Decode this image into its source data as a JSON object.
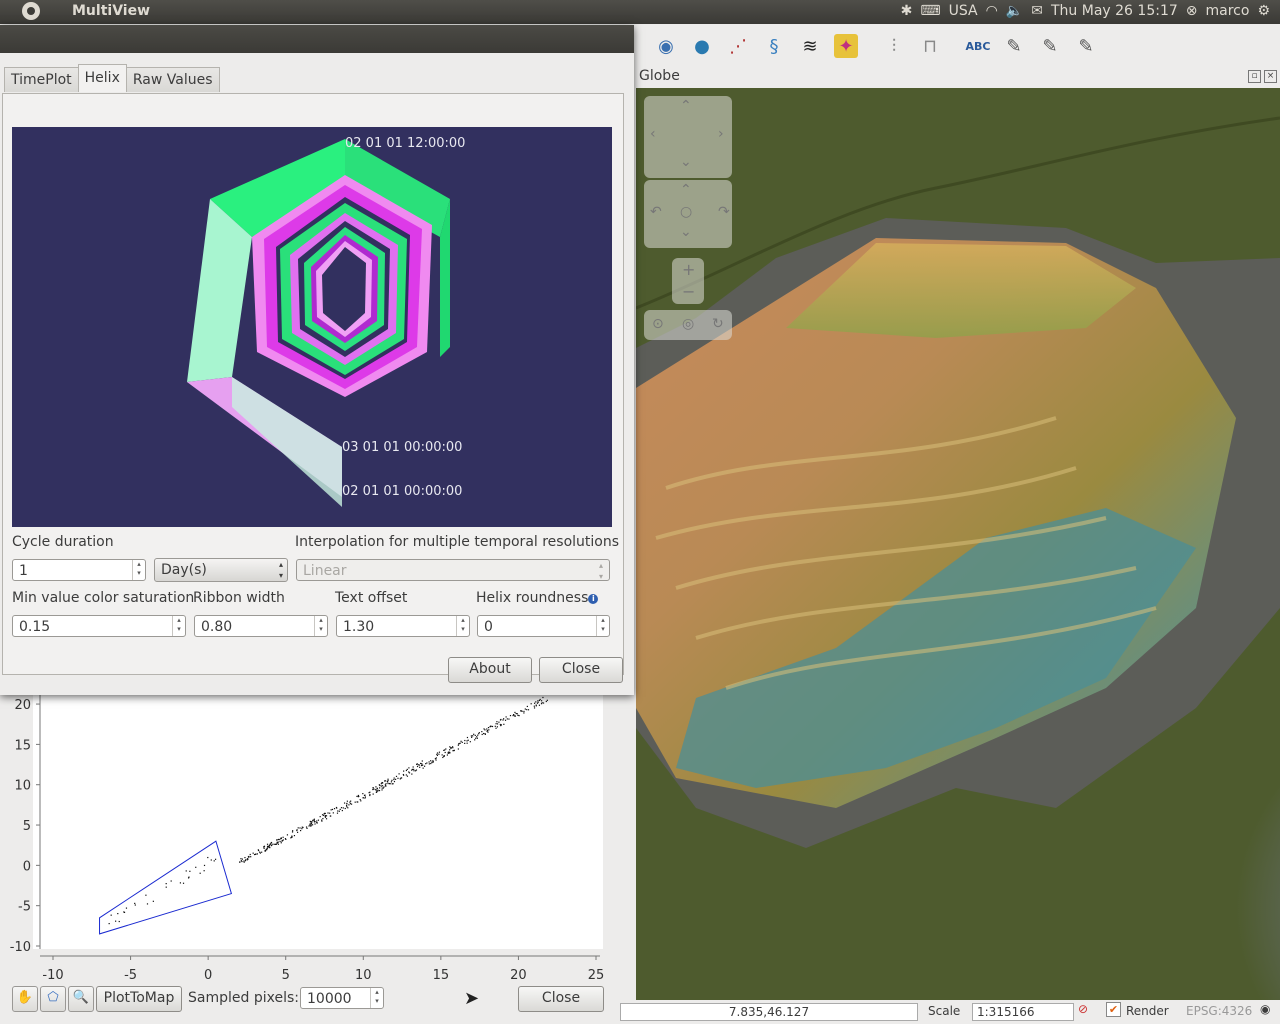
{
  "topbar": {
    "app_title": "MultiView",
    "keyboard": "USA",
    "datetime": "Thu May 26 15:17",
    "user": "marco"
  },
  "globe": {
    "title": "Globe",
    "toolbar_icons": [
      "globe-icon",
      "world-icon",
      "graph-icon",
      "dna-icon",
      "layers-icon",
      "color-icon",
      "chart-icon",
      "histogram-icon",
      "label-icon",
      "tool-icon",
      "tool-icon",
      "tool-icon"
    ]
  },
  "dialog": {
    "tabs": [
      "TimePlot",
      "Helix",
      "Raw Values"
    ],
    "active_tab": "Helix",
    "helix_labels": [
      "02 01 01 12:00:00",
      "03 01 01 00:00:00",
      "02 01 01 00:00:00"
    ],
    "cycle_duration_label": "Cycle duration",
    "cycle_duration_value": "1",
    "cycle_unit": "Day(s)",
    "interpolation_label": "Interpolation for multiple temporal resolutions",
    "interpolation_value": "Linear",
    "min_sat_label": "Min value color saturation",
    "min_sat_value": "0.15",
    "ribbon_width_label": "Ribbon width",
    "ribbon_width_value": "0.80",
    "text_offset_label": "Text offset",
    "text_offset_value": "1.30",
    "helix_roundness_label": "Helix roundness",
    "helix_roundness_value": "0",
    "about_label": "About",
    "close_label": "Close"
  },
  "plot": {
    "plot_to_map_label": "PlotToMap",
    "sampled_pixels_label": "Sampled pixels:",
    "sampled_pixels_value": "10000",
    "close_label": "Close"
  },
  "chart_data": {
    "type": "scatter",
    "x_ticks": [
      "-10",
      "-5",
      "0",
      "5",
      "10",
      "15",
      "20",
      "25"
    ],
    "y_ticks": [
      "20",
      "15",
      "10",
      "5",
      "0",
      "-5",
      "-10"
    ],
    "xlim": [
      -10,
      25
    ],
    "ylim": [
      -10,
      21
    ],
    "point_trend": {
      "x_from": 2,
      "y_from": 0.5,
      "x_to": 22,
      "y_to": 21
    },
    "selection_polygon": [
      [
        -7,
        -8.5
      ],
      [
        -7,
        -6.5
      ],
      [
        0.5,
        3
      ],
      [
        1.5,
        -3.5
      ]
    ]
  },
  "statusbar": {
    "coordinates": "7.835,46.127",
    "scale_label": "Scale",
    "scale_value": "1:315166",
    "render_label": "Render",
    "crs": "EPSG:4326"
  }
}
